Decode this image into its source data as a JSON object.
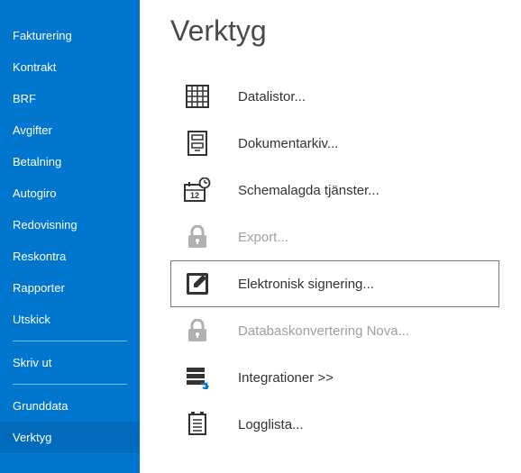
{
  "sidebar": {
    "items": [
      {
        "label": "Fakturering"
      },
      {
        "label": "Kontrakt"
      },
      {
        "label": "BRF"
      },
      {
        "label": "Avgifter"
      },
      {
        "label": "Betalning"
      },
      {
        "label": "Autogiro"
      },
      {
        "label": "Redovisning"
      },
      {
        "label": "Reskontra"
      },
      {
        "label": "Rapporter"
      },
      {
        "label": "Utskick"
      }
    ],
    "section2": [
      {
        "label": "Skriv ut"
      }
    ],
    "section3": [
      {
        "label": "Grunddata"
      },
      {
        "label": "Verktyg"
      }
    ]
  },
  "main": {
    "title": "Verktyg",
    "tools": [
      {
        "label": "Datalistor...",
        "icon": "grid",
        "disabled": false,
        "selected": false
      },
      {
        "label": "Dokumentarkiv...",
        "icon": "archive",
        "disabled": false,
        "selected": false
      },
      {
        "label": "Schemalagda tjänster...",
        "icon": "schedule",
        "disabled": false,
        "selected": false
      },
      {
        "label": "Export...",
        "icon": "lock",
        "disabled": true,
        "selected": false
      },
      {
        "label": "Elektronisk signering...",
        "icon": "sign",
        "disabled": false,
        "selected": true
      },
      {
        "label": "Databaskonvertering Nova...",
        "icon": "lock",
        "disabled": true,
        "selected": false
      },
      {
        "label": "Integrationer >>",
        "icon": "integrations",
        "disabled": false,
        "selected": false
      },
      {
        "label": "Logglista...",
        "icon": "log",
        "disabled": false,
        "selected": false
      }
    ]
  }
}
